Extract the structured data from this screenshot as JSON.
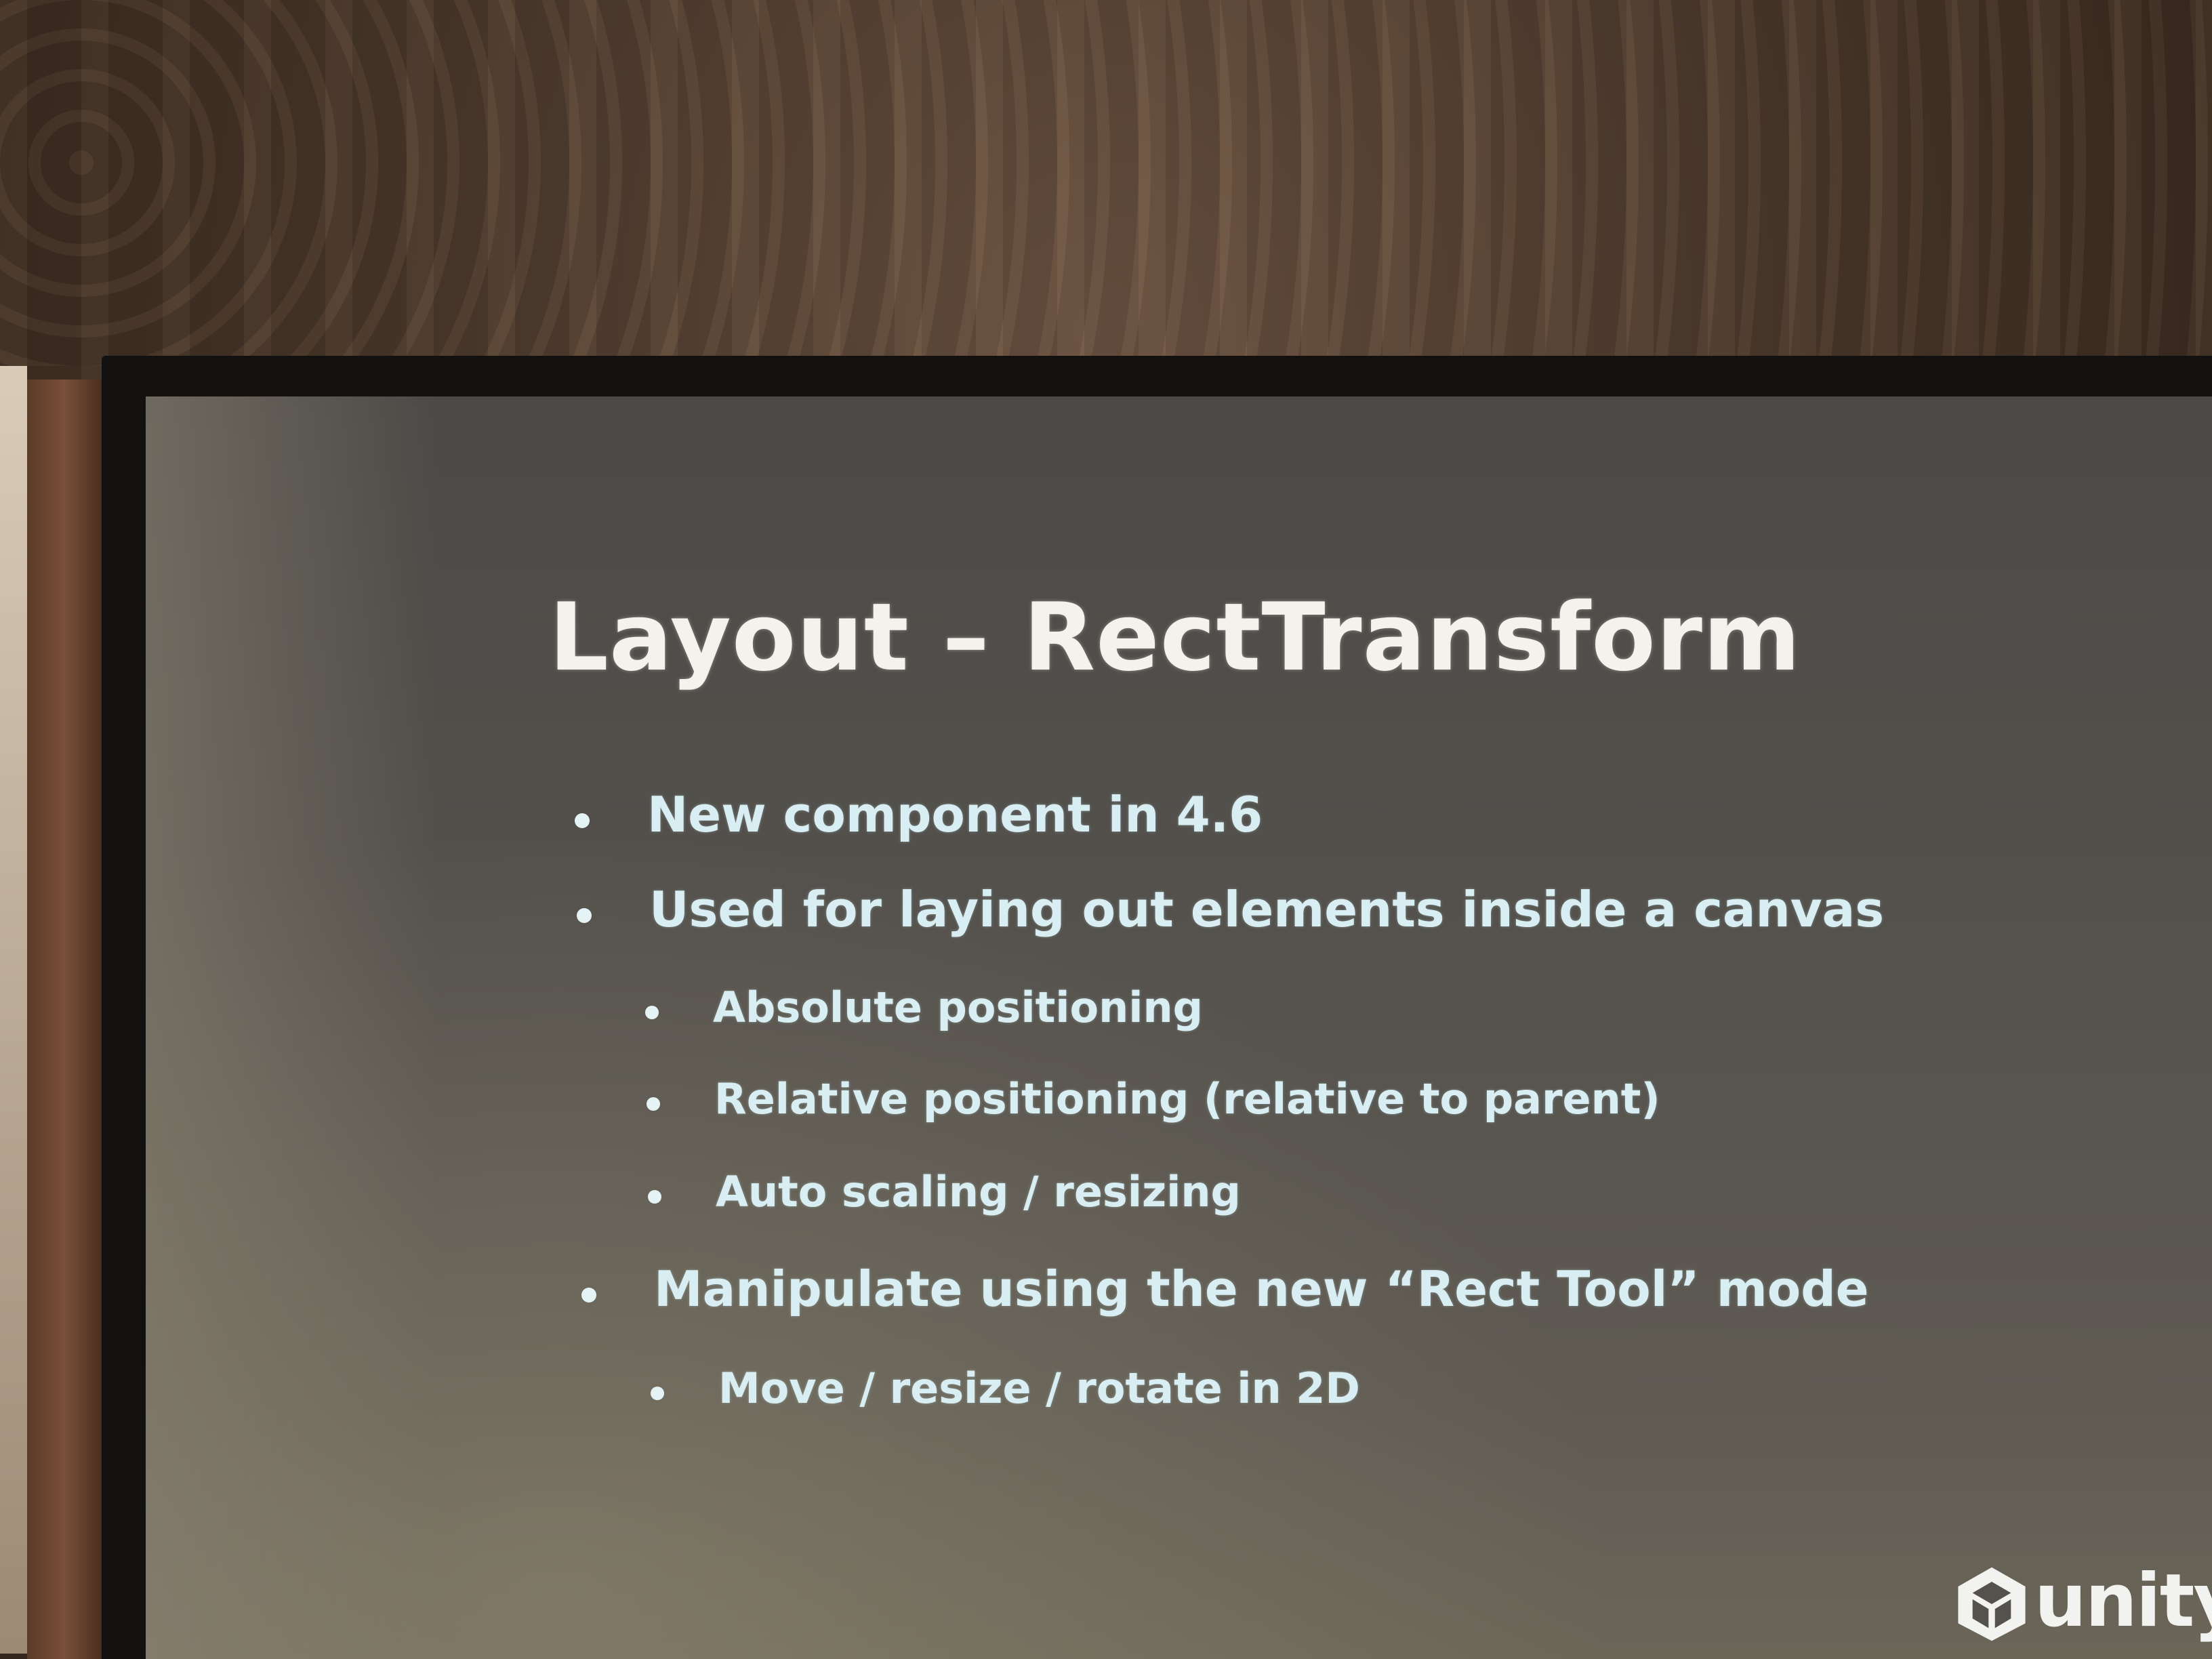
{
  "slide": {
    "title": "Layout – RectTransform",
    "bullets": [
      {
        "text": "New component in 4.6",
        "level": 1
      },
      {
        "text": "Used for laying out elements inside a canvas",
        "level": 1
      },
      {
        "text": "Absolute positioning",
        "level": 2
      },
      {
        "text": "Relative positioning (relative to parent)",
        "level": 2
      },
      {
        "text": "Auto scaling / resizing",
        "level": 2
      },
      {
        "text": "Manipulate using the new “Rect Tool” mode",
        "level": 1
      },
      {
        "text": "Move / resize / rotate in 2D",
        "level": 2
      }
    ]
  },
  "logo": {
    "text": "unity",
    "icon": "unity-cube-icon"
  },
  "colors": {
    "title": "#f4f2ea",
    "bullet_text": "#d9eef2",
    "screen": "#55524d",
    "frame": "#121110"
  }
}
